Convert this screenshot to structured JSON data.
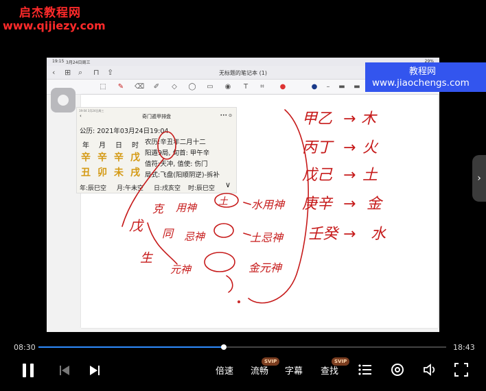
{
  "watermark_top": {
    "line1": "启杰教程网",
    "line2": "www.qijiezy.com"
  },
  "watermark_right": {
    "line1": "教程网",
    "line2": "www.jiaochengs.com"
  },
  "device": {
    "status_time": "19:15",
    "status_date": "3月24日周三",
    "status_battery": "29%",
    "note_title": "无标题的笔记本 (1)"
  },
  "chart_app": {
    "status": "19:04  3月24日周三",
    "title": "奇门遁甲排盘",
    "menu": "•••  ⊙",
    "date": "公历: 2021年03月24日19:04",
    "headers": [
      "年",
      "月",
      "日",
      "时"
    ],
    "stems": [
      "辛",
      "辛",
      "辛",
      "戊"
    ],
    "branches": [
      "丑",
      "卯",
      "未",
      "戌"
    ],
    "info": [
      "农历:辛丑年二月十二",
      "阳遁9局, 旬首: 甲午辛",
      "值符:天冲, 值使: 伤门",
      "局式:飞盘(阳顺阴逆)-拆补"
    ],
    "voids": [
      "年:辰巳空",
      "月:午未空",
      "日:戌亥空",
      "时:辰巳空"
    ]
  },
  "handwriting": {
    "mapping": [
      {
        "left": "甲乙",
        "arrow": "→",
        "right": "木"
      },
      {
        "left": "丙丁",
        "arrow": "→",
        "right": "火"
      },
      {
        "left": "戊己",
        "arrow": "→",
        "right": "土"
      },
      {
        "left": "庚辛",
        "arrow": "→",
        "right": "金"
      },
      {
        "left": "壬癸",
        "arrow": "→",
        "right": "水"
      }
    ],
    "notes": [
      "戊",
      "克",
      "用神",
      "土",
      "水用神",
      "同",
      "忌神",
      "土忌神",
      "生",
      "元神",
      "金元神"
    ]
  },
  "player": {
    "current_time": "08:30",
    "total_time": "18:43",
    "progress": 0.454,
    "speed_label": "倍速",
    "quality_label": "流畅",
    "subtitle_label": "字幕",
    "search_label": "查找",
    "badge": "SVIP"
  },
  "colors": {
    "ink": "#c61a1a",
    "accent": "#2f8cff",
    "gold": "#d49a15"
  }
}
